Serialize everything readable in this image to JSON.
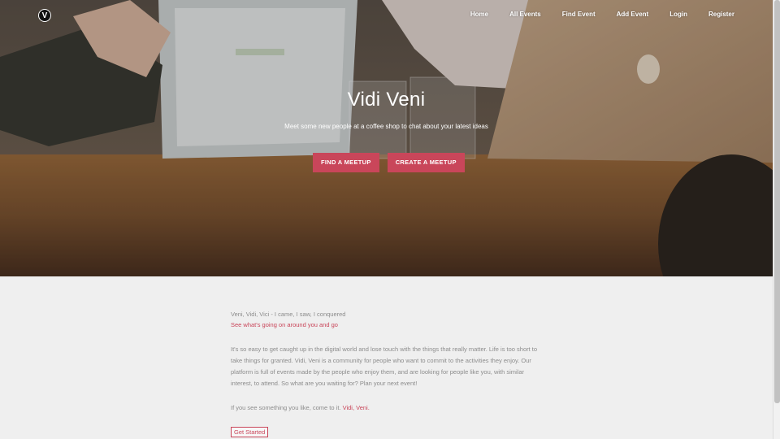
{
  "nav": {
    "logo_letter": "V",
    "items": [
      {
        "label": "Home"
      },
      {
        "label": "All Events"
      },
      {
        "label": "Find Event"
      },
      {
        "label": "Add Event"
      },
      {
        "label": "Login"
      },
      {
        "label": "Register"
      }
    ]
  },
  "hero": {
    "title": "Vidi Veni",
    "subtitle": "Meet some new people at a coffee shop to chat about your latest ideas",
    "buttons": {
      "find": "FIND A MEETUP",
      "create": "CREATE A MEETUP"
    }
  },
  "content": {
    "tagline": "Veni, Vidi, Vici - I came, I saw, I conquered",
    "tagline_link": "See what's going on around you and go",
    "paragraph": "It's so easy to get caught up in the digital world and lose touch with the things that really matter. Life is too short to take things for granted. Vidi, Veni is a community for people who want to commit to the activities they enjoy. Our platform is full of events made by the people who enjoy them, and are looking for people like you, with similar interest, to attend. So what are you waiting for? Plan your next event!",
    "closing_text": "If you see something you like, come to it.",
    "closing_brand": "Vidi, Veni.",
    "cta_button": "Get Started"
  },
  "colors": {
    "accent": "#c9465a",
    "page_background": "#efefef",
    "body_text": "#8c8c8c"
  }
}
